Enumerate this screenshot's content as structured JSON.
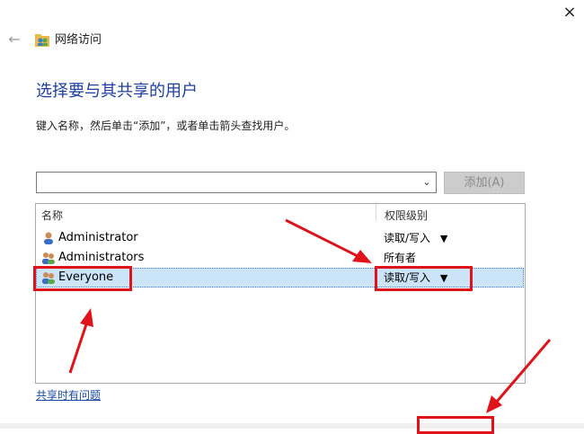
{
  "window": {
    "title": "网络访问",
    "close_icon": "×",
    "back_icon": "←"
  },
  "heading": "选择要与其共享的用户",
  "instruction": "键入名称，然后单击“添加”，或者单击箭头查找用户。",
  "input": {
    "value": "",
    "placeholder": ""
  },
  "add_button": {
    "label": "添加(A)"
  },
  "table": {
    "headers": {
      "name": "名称",
      "permission": "权限级别"
    },
    "rows": [
      {
        "name": "Administrator",
        "permission": "读取/写入",
        "has_dropdown": true,
        "icon": "single-user-icon"
      },
      {
        "name": "Administrators",
        "permission": "所有者",
        "has_dropdown": false,
        "icon": "group-users-icon"
      },
      {
        "name": "Everyone",
        "permission": "读取/写入",
        "has_dropdown": true,
        "selected": true,
        "icon": "group-users-icon"
      }
    ]
  },
  "link": "共享时有问题",
  "colors": {
    "heading": "#1f3f9e",
    "selection": "#cce4f7",
    "annotation": "#e0131b",
    "link": "#1a4aa8"
  }
}
